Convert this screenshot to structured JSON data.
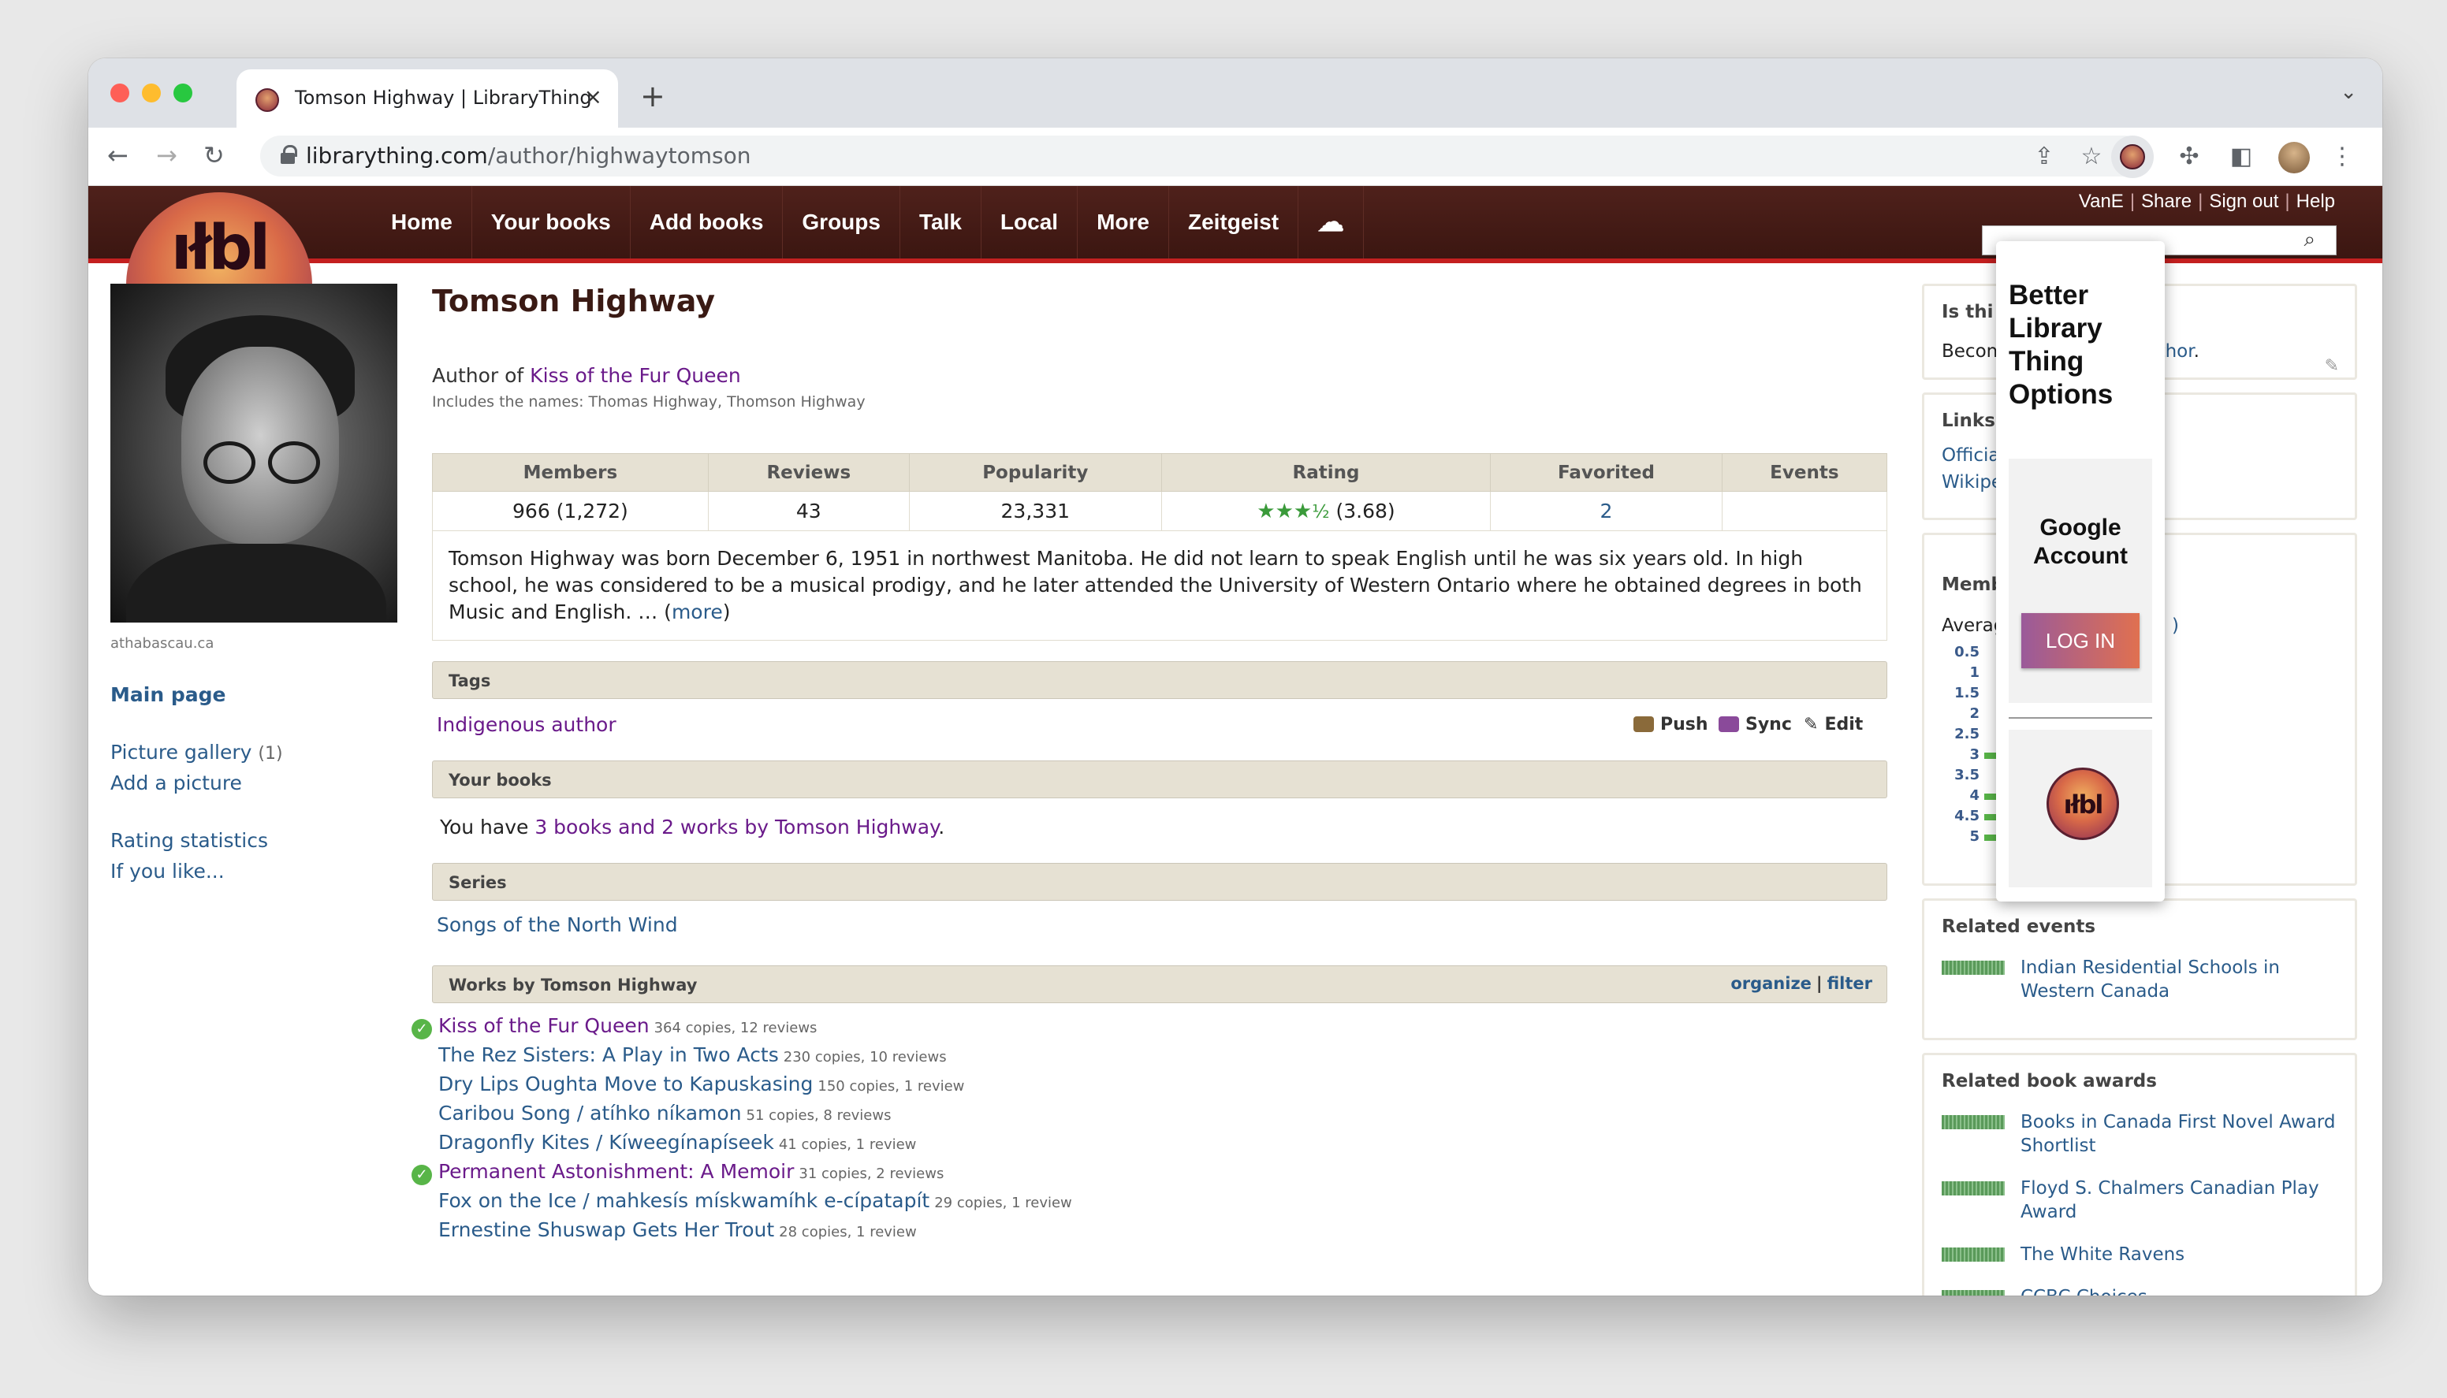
{
  "browser": {
    "tab_title": "Tomson Highway | LibraryThing",
    "url_host": "librarything.com",
    "url_path": "/author/highwaytomson"
  },
  "site": {
    "logo_text": "ıłbl",
    "nav": [
      "Home",
      "Your books",
      "Add books",
      "Groups",
      "Talk",
      "Local",
      "More",
      "Zeitgeist"
    ],
    "user_links": [
      "VanE",
      "Share",
      "Sign out",
      "Help"
    ]
  },
  "author": {
    "name": "Tomson Highway",
    "author_of_prefix": "Author of ",
    "author_of_title": "Kiss of the Fur Queen",
    "includes_names": "Includes the names: Thomas Highway, Thomson Highway",
    "photo_caption": "athabascau.ca"
  },
  "left_nav": {
    "main_page": "Main page",
    "picture_gallery": "Picture gallery",
    "picture_count": "(1)",
    "add_picture": "Add a picture",
    "rating_statistics": "Rating statistics",
    "if_you_like": "If you like..."
  },
  "stats": {
    "headers": [
      "Members",
      "Reviews",
      "Popularity",
      "Rating",
      "Favorited",
      "Events"
    ],
    "members": "966 (1,272)",
    "reviews": "43",
    "popularity": "23,331",
    "rating": "(3.68)",
    "rating_stars": 3.5,
    "favorited": "2",
    "events": ""
  },
  "bio": {
    "text": "Tomson Highway was born December 6, 1951 in northwest Manitoba. He did not learn to speak English until he was six years old. In high school, he was considered to be a musical prodigy, and he later attended the University of Western Ontario where he obtained degrees in both Music and English. … (",
    "more": "more",
    "close": ")"
  },
  "tags": {
    "header": "Tags",
    "tag": "Indigenous author",
    "push": "Push",
    "sync": "Sync",
    "edit": "Edit"
  },
  "your_books": {
    "header": "Your books",
    "prefix": "You have ",
    "link": "3 books and 2 works by Tomson Highway",
    "suffix": "."
  },
  "series": {
    "header": "Series",
    "item": "Songs of the North Wind"
  },
  "works": {
    "header": "Works by Tomson Highway",
    "organize": "organize",
    "sep": "|",
    "filter": "filter",
    "items": [
      {
        "title": "Kiss of the Fur Queen",
        "meta": "364 copies, 12 reviews",
        "owned": true
      },
      {
        "title": "The Rez Sisters: A Play in Two Acts",
        "meta": "230 copies, 10 reviews",
        "owned": false
      },
      {
        "title": "Dry Lips Oughta Move to Kapuskasing",
        "meta": "150 copies, 1 review",
        "owned": false
      },
      {
        "title": "Caribou Song / atíhko níkamon",
        "meta": "51 copies, 8 reviews",
        "owned": false
      },
      {
        "title": "Dragonfly Kites / Kíweegínapíseek",
        "meta": "41 copies, 1 review",
        "owned": false
      },
      {
        "title": "Permanent Astonishment: A Memoir",
        "meta": "31 copies, 2 reviews",
        "owned": true
      },
      {
        "title": "Fox on the Ice / mahkesís mískwamíhk e-cípatapít",
        "meta": "29 copies, 1 review",
        "owned": false
      },
      {
        "title": "Ernestine Shuswap Gets Her Trout",
        "meta": "28 copies, 1 review",
        "owned": false
      }
    ]
  },
  "right": {
    "is_this": "Is thi",
    "become": "Becon",
    "author_link": "uthor",
    "links_header": "Links",
    "link1": "Officia",
    "link2": "Wikipe",
    "members_header": "Memb",
    "average": "Averag",
    "avg_tail": ")",
    "hist": [
      {
        "label": "0.5",
        "count": ""
      },
      {
        "label": "1",
        "count": ""
      },
      {
        "label": "1.5",
        "count": ""
      },
      {
        "label": "2",
        "count": ""
      },
      {
        "label": "2.5",
        "count": ""
      },
      {
        "label": "3",
        "count": "40"
      },
      {
        "label": "3.5",
        "count": ""
      },
      {
        "label": "4",
        "count": "45"
      },
      {
        "label": "4.5",
        "count": "14"
      },
      {
        "label": "5",
        "count": "27"
      }
    ],
    "related_events_header": "Related events",
    "events": [
      "Indian Residential Schools in Western Canada"
    ],
    "related_awards_header": "Related book awards",
    "awards": [
      "Books in Canada First Novel Award Shortlist",
      "Floyd S. Chalmers Canadian Play Award",
      "The White Ravens",
      "CCBC Choices"
    ]
  },
  "extension_popup": {
    "title_lines": [
      "Better",
      "Library",
      "Thing",
      "Options"
    ],
    "google_lines": [
      "Google",
      "Account"
    ],
    "login": "LOG IN",
    "logo_text": "ıłbl"
  },
  "colors": {
    "nav_bg": "#4f211b",
    "nav_border": "#c42020",
    "link": "#2a5b8a",
    "visited": "#6a1a8a",
    "section_bg": "#e6e1d3",
    "green": "#58b548"
  }
}
